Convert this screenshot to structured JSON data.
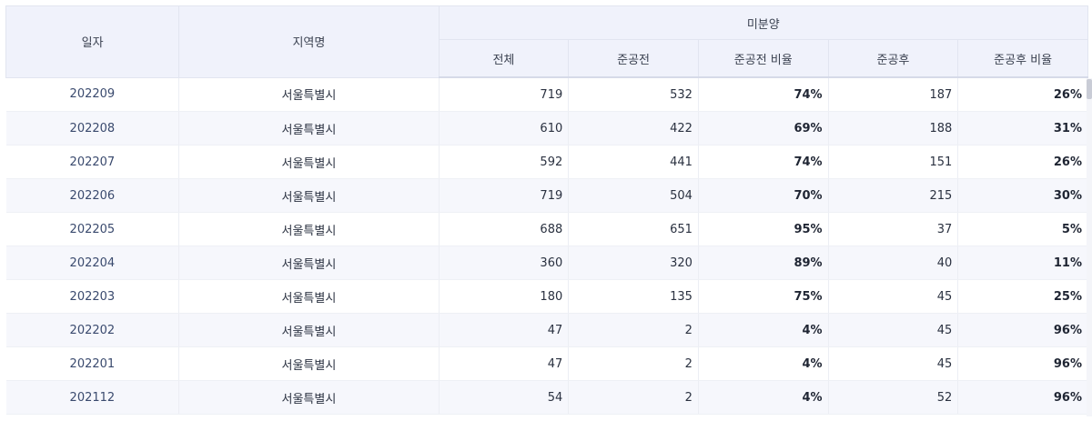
{
  "table": {
    "headers": {
      "date": "일자",
      "region": "지역명",
      "group": "미분양",
      "total": "전체",
      "before": "준공전",
      "before_ratio": "준공전 비율",
      "after": "준공후",
      "after_ratio": "준공후 비율"
    },
    "rows": [
      {
        "date": "202209",
        "region": "서울특별시",
        "total": "719",
        "before": "532",
        "before_ratio": "74%",
        "after": "187",
        "after_ratio": "26%"
      },
      {
        "date": "202208",
        "region": "서울특별시",
        "total": "610",
        "before": "422",
        "before_ratio": "69%",
        "after": "188",
        "after_ratio": "31%"
      },
      {
        "date": "202207",
        "region": "서울특별시",
        "total": "592",
        "before": "441",
        "before_ratio": "74%",
        "after": "151",
        "after_ratio": "26%"
      },
      {
        "date": "202206",
        "region": "서울특별시",
        "total": "719",
        "before": "504",
        "before_ratio": "70%",
        "after": "215",
        "after_ratio": "30%"
      },
      {
        "date": "202205",
        "region": "서울특별시",
        "total": "688",
        "before": "651",
        "before_ratio": "95%",
        "after": "37",
        "after_ratio": "5%"
      },
      {
        "date": "202204",
        "region": "서울특별시",
        "total": "360",
        "before": "320",
        "before_ratio": "89%",
        "after": "40",
        "after_ratio": "11%"
      },
      {
        "date": "202203",
        "region": "서울특별시",
        "total": "180",
        "before": "135",
        "before_ratio": "75%",
        "after": "45",
        "after_ratio": "25%"
      },
      {
        "date": "202202",
        "region": "서울특별시",
        "total": "47",
        "before": "2",
        "before_ratio": "4%",
        "after": "45",
        "after_ratio": "96%"
      },
      {
        "date": "202201",
        "region": "서울특별시",
        "total": "47",
        "before": "2",
        "before_ratio": "4%",
        "after": "45",
        "after_ratio": "96%"
      },
      {
        "date": "202112",
        "region": "서울특별시",
        "total": "54",
        "before": "2",
        "before_ratio": "4%",
        "after": "52",
        "after_ratio": "96%"
      }
    ]
  },
  "colors": {
    "header_bg": "#f0f2fb",
    "stripe_bg": "#f6f7fc",
    "date_text": "#3a4a6e"
  }
}
